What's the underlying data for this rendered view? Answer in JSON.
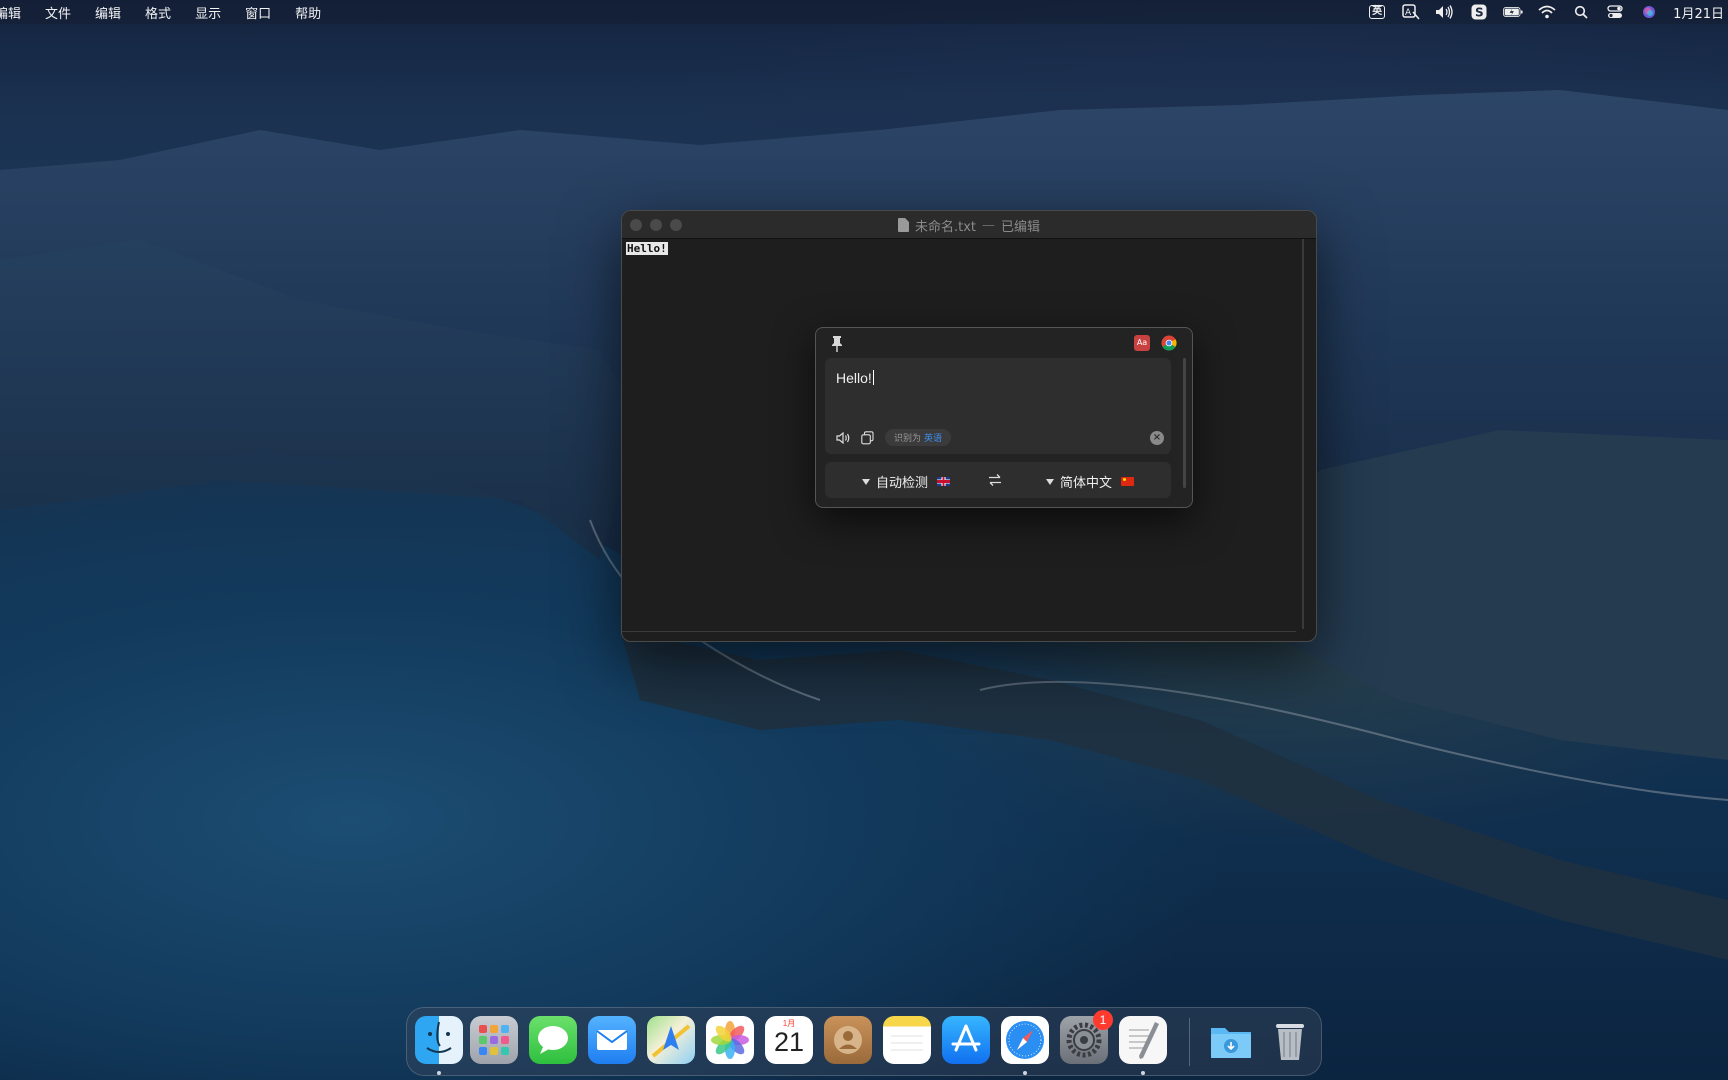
{
  "menubar": {
    "app_name": "编辑",
    "items": [
      "文件",
      "编辑",
      "格式",
      "显示",
      "窗口",
      "帮助"
    ],
    "status": {
      "input_method": "英",
      "clock": "1月21日"
    }
  },
  "window": {
    "title": "未命名.txt",
    "title_sep": "—",
    "subtitle": "已编辑",
    "content": "Hello!"
  },
  "translator": {
    "input_text": "Hello!",
    "detected_prefix": "识别为",
    "detected_lang": "英语",
    "source_lang": "自动检测",
    "target_lang": "简体中文",
    "dict_label": "Aa"
  },
  "dock": {
    "apps": [
      "finder",
      "launchpad",
      "messages",
      "mail",
      "maps",
      "photos",
      "calendar",
      "contacts",
      "notes",
      "app-store",
      "safari",
      "system-preferences",
      "textedit",
      "downloads",
      "trash"
    ],
    "calendar_month": "1月",
    "calendar_day": "21",
    "system_preferences_badge": "1"
  }
}
